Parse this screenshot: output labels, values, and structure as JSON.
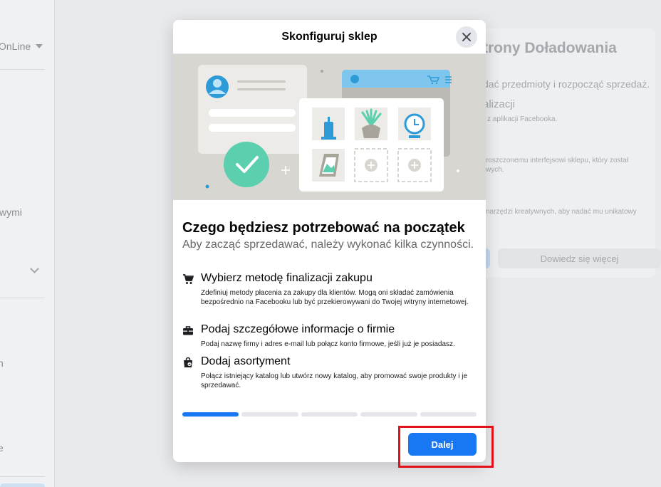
{
  "background": {
    "sidebar": {
      "account_label": "OnLine",
      "item_partial_1": "wymi",
      "item_partial_2": "n",
      "item_partial_3": "e"
    },
    "card": {
      "title_partial": "trony Doładowania",
      "line1": "dać przedmioty i rozpocząć sprzedaż.",
      "line2": "alizacji",
      "line3": "z aplikacji Facebooka.",
      "line4": "roszczonemu interfejsowi sklepu, który został",
      "line5": "wych.",
      "line6": "narzędzi kreatywnych, aby nadać mu unikatowy",
      "learn_more": "Dowiedz się więcej"
    }
  },
  "modal": {
    "title": "Skonfiguruj sklep",
    "heading": "Czego będziesz potrzebować na początek",
    "subheading": "Aby zacząć sprzedawać, należy wykonać kilka czynności.",
    "steps": [
      {
        "icon": "cart-icon",
        "title": "Wybierz metodę finalizacji zakupu",
        "description": "Zdefiniuj metody płacenia za zakupy dla klientów. Mogą oni składać zamówienia bezpośrednio na Facebooku lub być przekierowywani do Twojej witryny internetowej."
      },
      {
        "icon": "briefcase-icon",
        "title": "Podaj szczegółowe informacje o firmie",
        "description": "Podaj nazwę firmy i adres e-mail lub połącz konto firmowe, jeśli już je posiadasz."
      },
      {
        "icon": "shopping-bag-icon",
        "title": "Dodaj asortyment",
        "description": "Połącz istniejący katalog lub utwórz nowy katalog, aby promować swoje produkty i je sprzedawać."
      }
    ],
    "progress": {
      "total_steps": 5,
      "current_step": 1
    },
    "next_button": "Dalej"
  },
  "colors": {
    "accent": "#1877f2",
    "highlight": "#e3101a",
    "illustration_bg": "#d8d6d0",
    "check_green": "#5ccfae"
  }
}
